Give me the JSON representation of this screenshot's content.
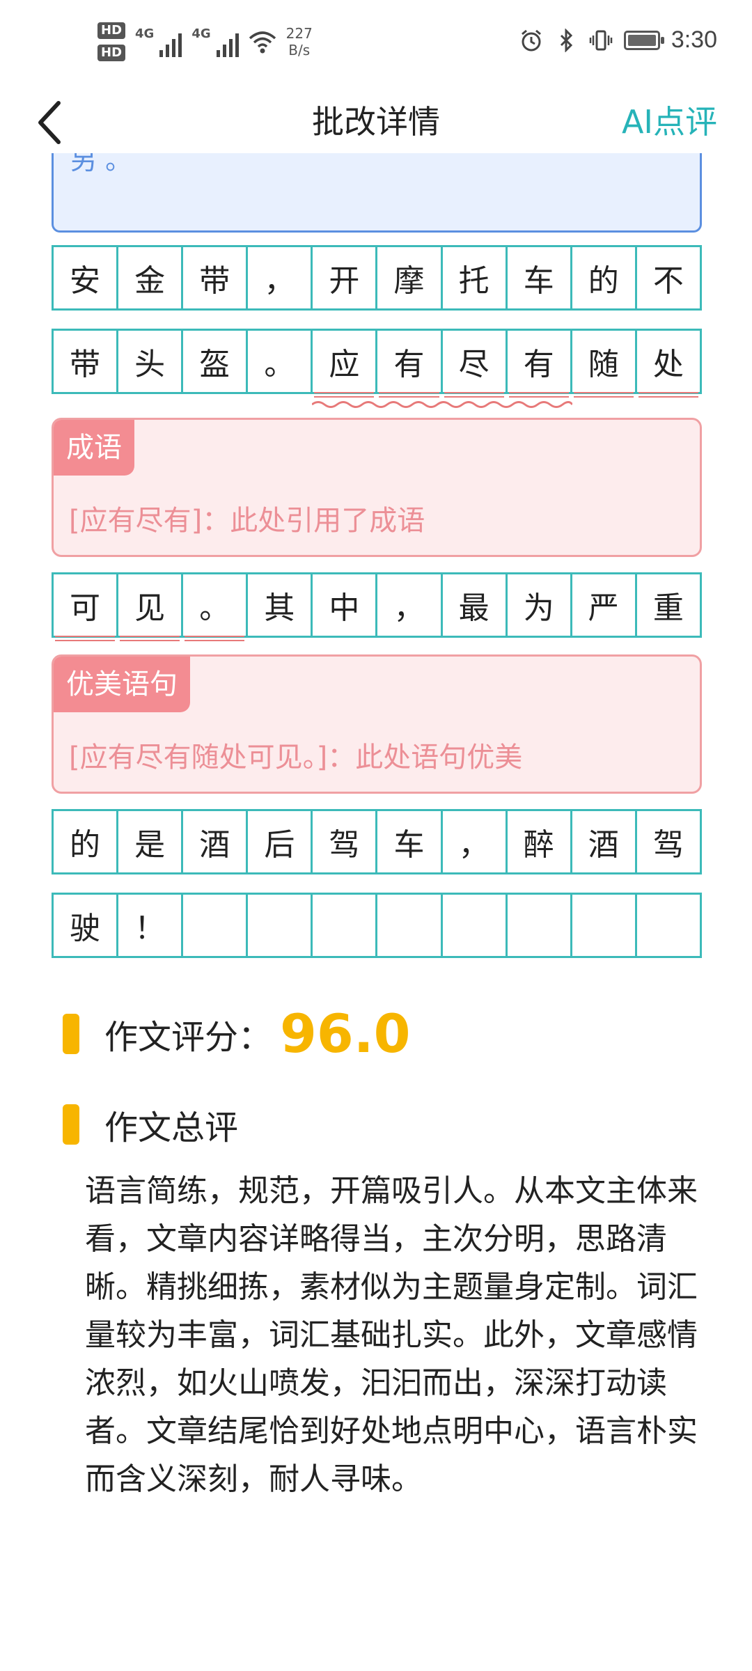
{
  "status_bar": {
    "hd1": "HD",
    "hd2": "HD",
    "sim1_label": "4G",
    "sim2_label": "4G",
    "net_speed_value": "227",
    "net_speed_unit": "B/s",
    "time": "3:30",
    "icons": [
      "alarm-icon",
      "bluetooth-icon",
      "vibrate-icon",
      "battery-icon"
    ]
  },
  "header": {
    "title": "批改详情",
    "ai_label": "AI点评",
    "back_icon": "chevron-left-icon"
  },
  "essay": {
    "top_card_fragment": "另 。",
    "rows": [
      [
        "安",
        "金",
        "带",
        "，",
        "开",
        "摩",
        "托",
        "车",
        "的",
        "不"
      ],
      [
        "带",
        "头",
        "盔",
        "。",
        "应",
        "有",
        "尽",
        "有",
        "随",
        "处"
      ],
      [
        "可",
        "见",
        "。",
        "其",
        "中",
        "，",
        "最",
        "为",
        "严",
        "重"
      ],
      [
        "的",
        "是",
        "酒",
        "后",
        "驾",
        "车",
        "，",
        "醉",
        "酒",
        "驾"
      ],
      [
        "驶",
        "！",
        "",
        "",
        "",
        "",
        "",
        "",
        "",
        ""
      ]
    ]
  },
  "comments": [
    {
      "tag": "成语",
      "text": "[应有尽有]：此处引用了成语"
    },
    {
      "tag": "优美语句",
      "text": "[应有尽有随处可见。]：此处语句优美"
    }
  ],
  "score": {
    "label": "作文评分：",
    "value": "96.0"
  },
  "summary": {
    "label": "作文总评",
    "text": "语言简练，规范，开篇吸引人。从本文主体来看，文章内容详略得当，主次分明，思路清晰。精挑细拣，素材似为主题量身定制。词汇量较为丰富，词汇基础扎实。此外，文章感情浓烈，如火山喷发，汩汩而出，深深打动读者。文章结尾恰到好处地点明中心，语言朴实而含义深刻，耐人寻味。"
  },
  "colors": {
    "accent_teal": "#26b3b8",
    "grid": "#3cbab9",
    "score_yellow": "#f7b500",
    "comment_pink": "#f38c92"
  }
}
